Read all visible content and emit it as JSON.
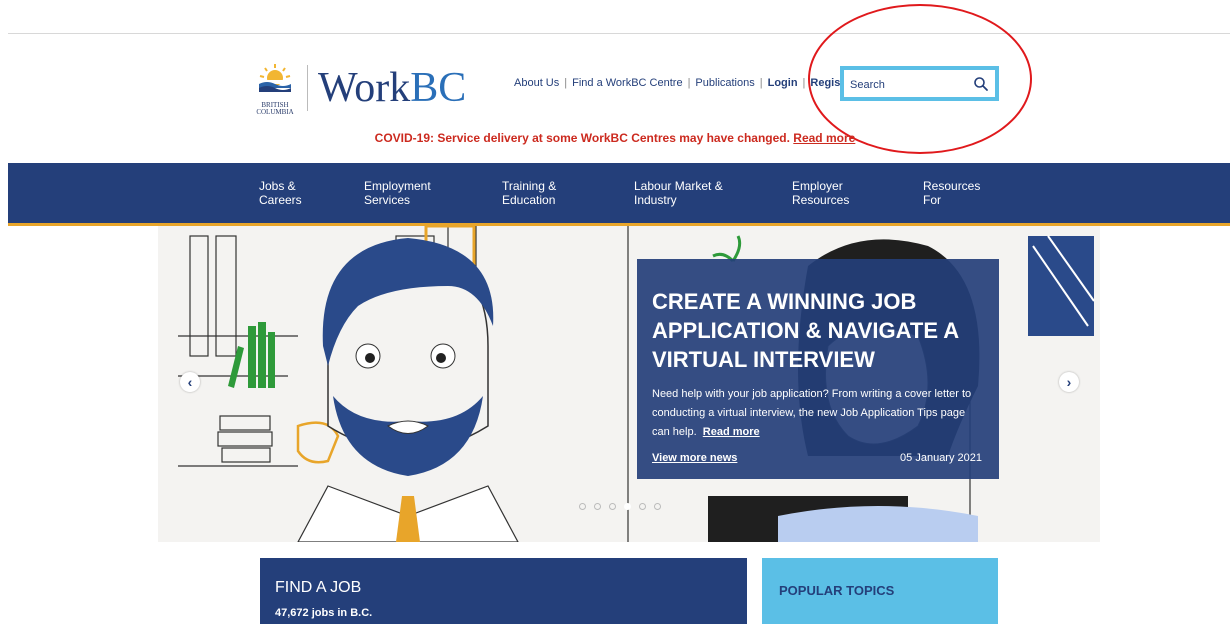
{
  "logo": {
    "crest_text_line1": "BRITISH",
    "crest_text_line2": "COLUMBIA",
    "wordmark_work": "Work",
    "wordmark_bc": "BC"
  },
  "utility_nav": {
    "about": "About Us",
    "find_centre": "Find a WorkBC Centre",
    "publications": "Publications",
    "login": "Login",
    "register": "Register"
  },
  "search": {
    "placeholder": "Search",
    "icon": "search-icon"
  },
  "covid_banner": {
    "text": "COVID-19: Service delivery at some WorkBC Centres may have changed.",
    "link": "Read more"
  },
  "main_nav": [
    {
      "line1": "Jobs &",
      "line2": "Careers"
    },
    {
      "line1": "Employment",
      "line2": "Services"
    },
    {
      "line1": "Training &",
      "line2": "Education"
    },
    {
      "line1": "Labour Market &",
      "line2": "Industry"
    },
    {
      "line1": "Employer",
      "line2": "Resources"
    },
    {
      "line1": "Resources",
      "line2": "For"
    }
  ],
  "hero": {
    "title": "CREATE A WINNING JOB APPLICATION & NAVIGATE A VIRTUAL INTERVIEW",
    "body": "Need help with your job application? From writing a cover letter to conducting a virtual interview, the new Job Application Tips page can help.",
    "read_more": "Read more",
    "view_more": "View more news",
    "date": "05 January 2021",
    "prev_icon": "chevron-left-icon",
    "next_icon": "chevron-right-icon",
    "slide_count": 6,
    "active_slide": 4
  },
  "find_job": {
    "title": "FIND A JOB",
    "count": "47,672 jobs in B.C."
  },
  "popular_topics": {
    "title": "POPULAR TOPICS"
  },
  "colors": {
    "navy": "#243f7a",
    "accent_gold": "#e8a52a",
    "search_border": "#5bbfe6",
    "covid_red": "#cc2a1f",
    "annotation_red": "#e0191c"
  }
}
